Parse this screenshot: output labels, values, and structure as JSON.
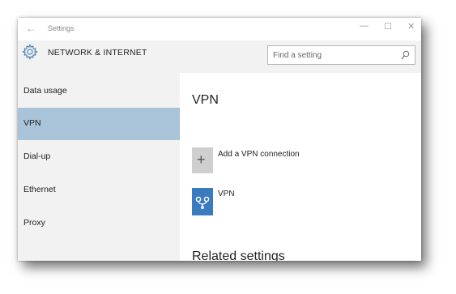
{
  "window": {
    "app_title": "Settings",
    "back_icon": "back-arrow-icon",
    "controls": {
      "minimize": "—",
      "maximize": "☐",
      "close": "✕"
    }
  },
  "header": {
    "icon": "gear-icon",
    "title": "NETWORK & INTERNET",
    "search_placeholder": "Find a setting"
  },
  "sidebar": {
    "items": [
      {
        "label": "Data usage",
        "active": false
      },
      {
        "label": "VPN",
        "active": true
      },
      {
        "label": "Dial-up",
        "active": false
      },
      {
        "label": "Ethernet",
        "active": false
      },
      {
        "label": "Proxy",
        "active": false
      }
    ]
  },
  "content": {
    "title": "VPN",
    "add_connection_label": "Add a VPN connection",
    "vpn_entry_label": "VPN",
    "related_title": "Related settings"
  },
  "colors": {
    "active_nav": "#a9c3d9",
    "vpn_tile": "#3a7bbf",
    "sidebar_bg": "#f2f2f2"
  }
}
